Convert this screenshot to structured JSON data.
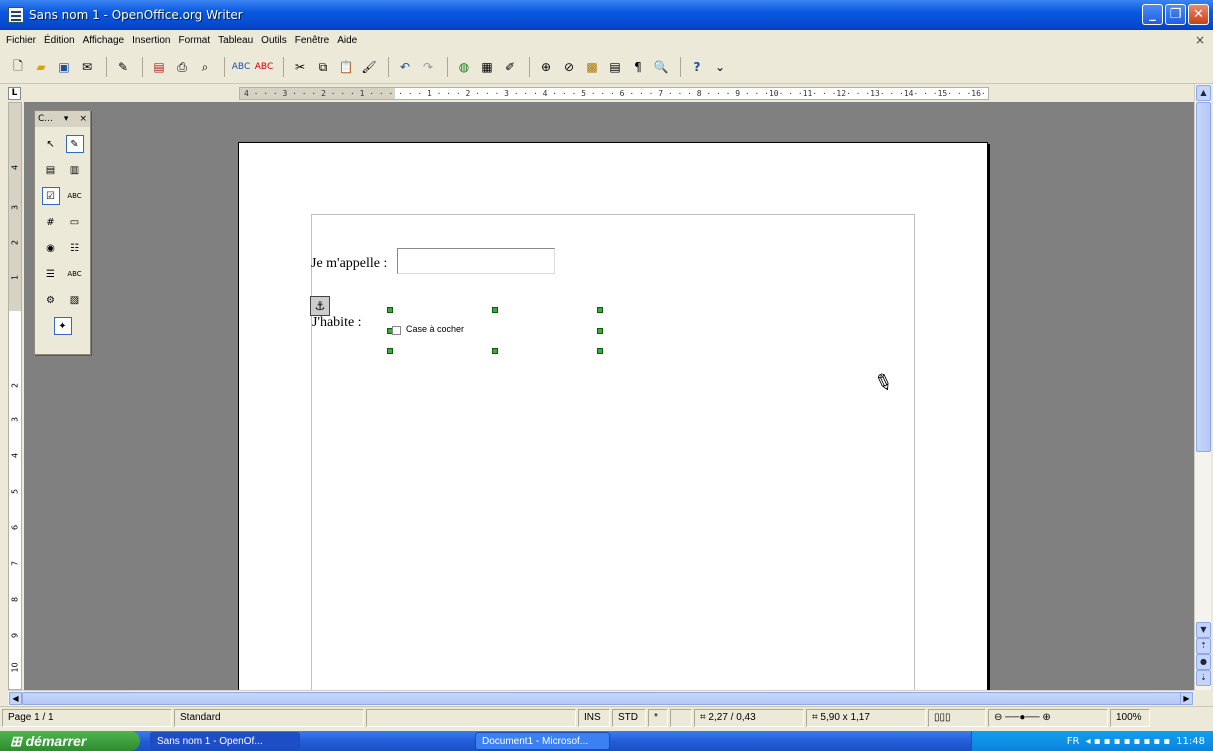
{
  "window": {
    "title": "Sans nom 1 - OpenOffice.org Writer"
  },
  "menu": [
    "Fichier",
    "Édition",
    "Affichage",
    "Insertion",
    "Format",
    "Tableau",
    "Outils",
    "Fenêtre",
    "Aide"
  ],
  "ruler": {
    "corner": "L",
    "horizontal": "4 · · · 3 · · · 2 · · · 1 · · ·   · · · 1 · · · 2 · · · 3 · · · 4 · · · 5 · · · 6 · · · 7 · · · 8 · · · 9 · · ·10· · ·11· · ·12· · ·13· · ·14· · ·15· · ·16· ·"
  },
  "formtoolbar": {
    "title": "C...",
    "dropdown": "▾",
    "close": "×"
  },
  "document": {
    "label_name": "Je m'appelle :",
    "label_live": "J'habite :",
    "checkbox_label": "Case à cocher"
  },
  "status": {
    "page": "Page 1 / 1",
    "style": "Standard",
    "ins": "INS",
    "std": "STD",
    "modified": "*",
    "position": "2,27 / 0,43",
    "size": "5,90 x 1,17",
    "zoom": "100%"
  },
  "taskbar": {
    "start": "démarrer",
    "items": [
      "Sans nom 1 - OpenOf...",
      "Document1 - Microsof..."
    ],
    "lang": "FR",
    "clock": "11:48"
  },
  "colors": {
    "titlebar": "#0a58e0",
    "workspace": "#808080",
    "handle": "#3fa93f",
    "tray": "#0c82db"
  }
}
